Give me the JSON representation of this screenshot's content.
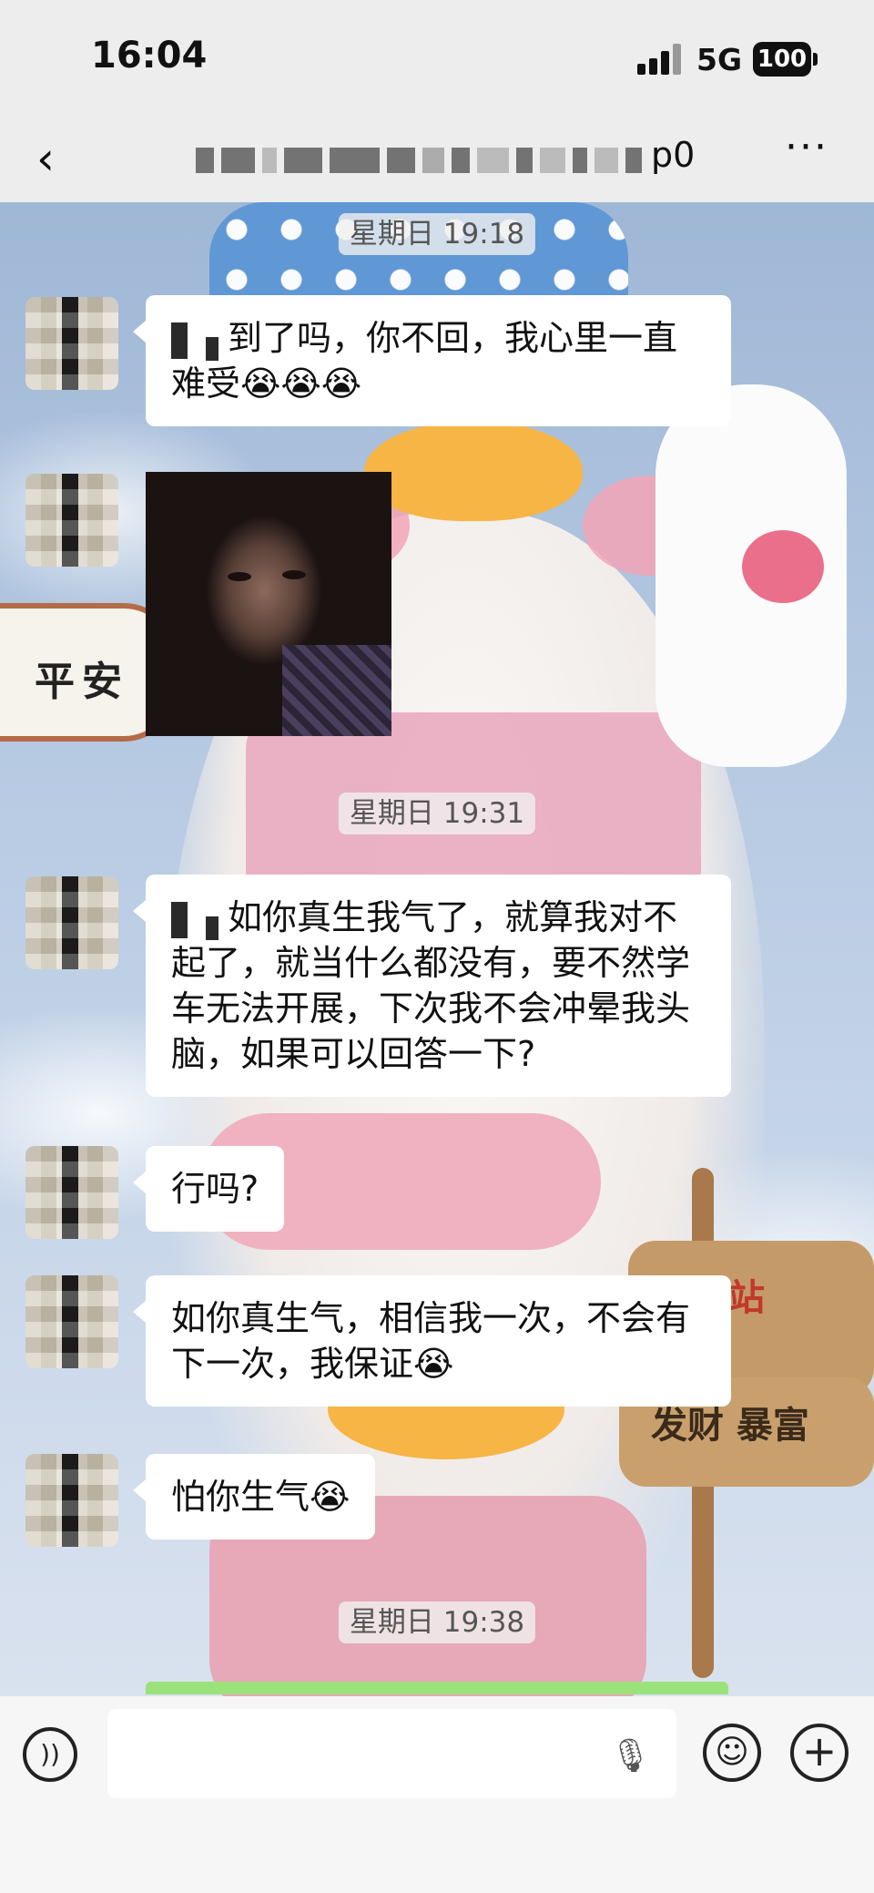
{
  "status_bar": {
    "time": "16:04",
    "network": "5G",
    "battery": "100"
  },
  "nav": {
    "back_icon": "chevron-left-icon",
    "title_visible_suffix": "p0",
    "more_icon": "more-icon"
  },
  "messages": [
    {
      "type": "timestamp",
      "text": "星期日 19:18"
    },
    {
      "type": "text",
      "text": "到了吗，你不回，我心里一直难受😭😭😭",
      "redacted_prefix": true
    },
    {
      "type": "image",
      "description": "crying-man-sticker"
    },
    {
      "type": "timestamp",
      "text": "星期日 19:31"
    },
    {
      "type": "text",
      "text": "如你真生我气了，就算我对不起了，就当什么都没有，要不然学车无法开展，下次我不会冲晕我头脑，如果可以回答一下?",
      "redacted_prefix": true
    },
    {
      "type": "text",
      "text": "行吗?"
    },
    {
      "type": "text",
      "text": "如你真生气，相信我一次，不会有下一次，我保证😭"
    },
    {
      "type": "text",
      "text": "怕你生气😭"
    },
    {
      "type": "timestamp",
      "text": "星期日 19:38"
    }
  ],
  "wallpaper": {
    "sign_left": "平安",
    "sign_right_1": "一站",
    "sign_right_2": "发财 暴富"
  },
  "input_bar": {
    "voice_icon": "voice-icon",
    "mic_icon": "microphone-icon",
    "emoji_icon": "emoji-icon",
    "plus_icon": "plus-icon"
  },
  "colors": {
    "bubble": "#ffffff",
    "accent_green": "#9be27a",
    "bar_bg": "#ededed"
  }
}
